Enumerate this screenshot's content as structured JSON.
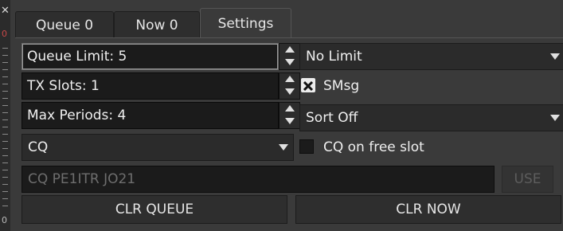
{
  "edge": {
    "close_glyph": "✕",
    "marker_top": "0",
    "marker_bottom": "0"
  },
  "tabs": [
    {
      "label": "Queue 0"
    },
    {
      "label": "Now 0"
    },
    {
      "label": "Settings"
    }
  ],
  "settings": {
    "queue_limit": "Queue Limit:  5",
    "tx_slots": "TX Slots:  1",
    "max_periods": "Max Periods:  4",
    "limit_combo": "No Limit",
    "smsg_label": "SMsg",
    "smsg_checked": true,
    "sort_combo": "Sort Off",
    "cq_combo": "CQ",
    "cq_free_slot_label": "CQ on free slot",
    "cq_free_slot_checked": false,
    "message_placeholder": "CQ PE1ITR JO21",
    "use_label": "USE",
    "clr_queue_label": "CLR QUEUE",
    "clr_now_label": "CLR NOW"
  },
  "colors": {
    "panel_bg": "#3a3a3a",
    "field_bg": "#1b1b1b",
    "text": "#e8e8e8",
    "disabled_text": "#6e6e6e"
  },
  "icons": [
    "close-icon",
    "spin-up-icon",
    "spin-down-icon",
    "dropdown-arrow-icon",
    "checkmark-icon"
  ]
}
